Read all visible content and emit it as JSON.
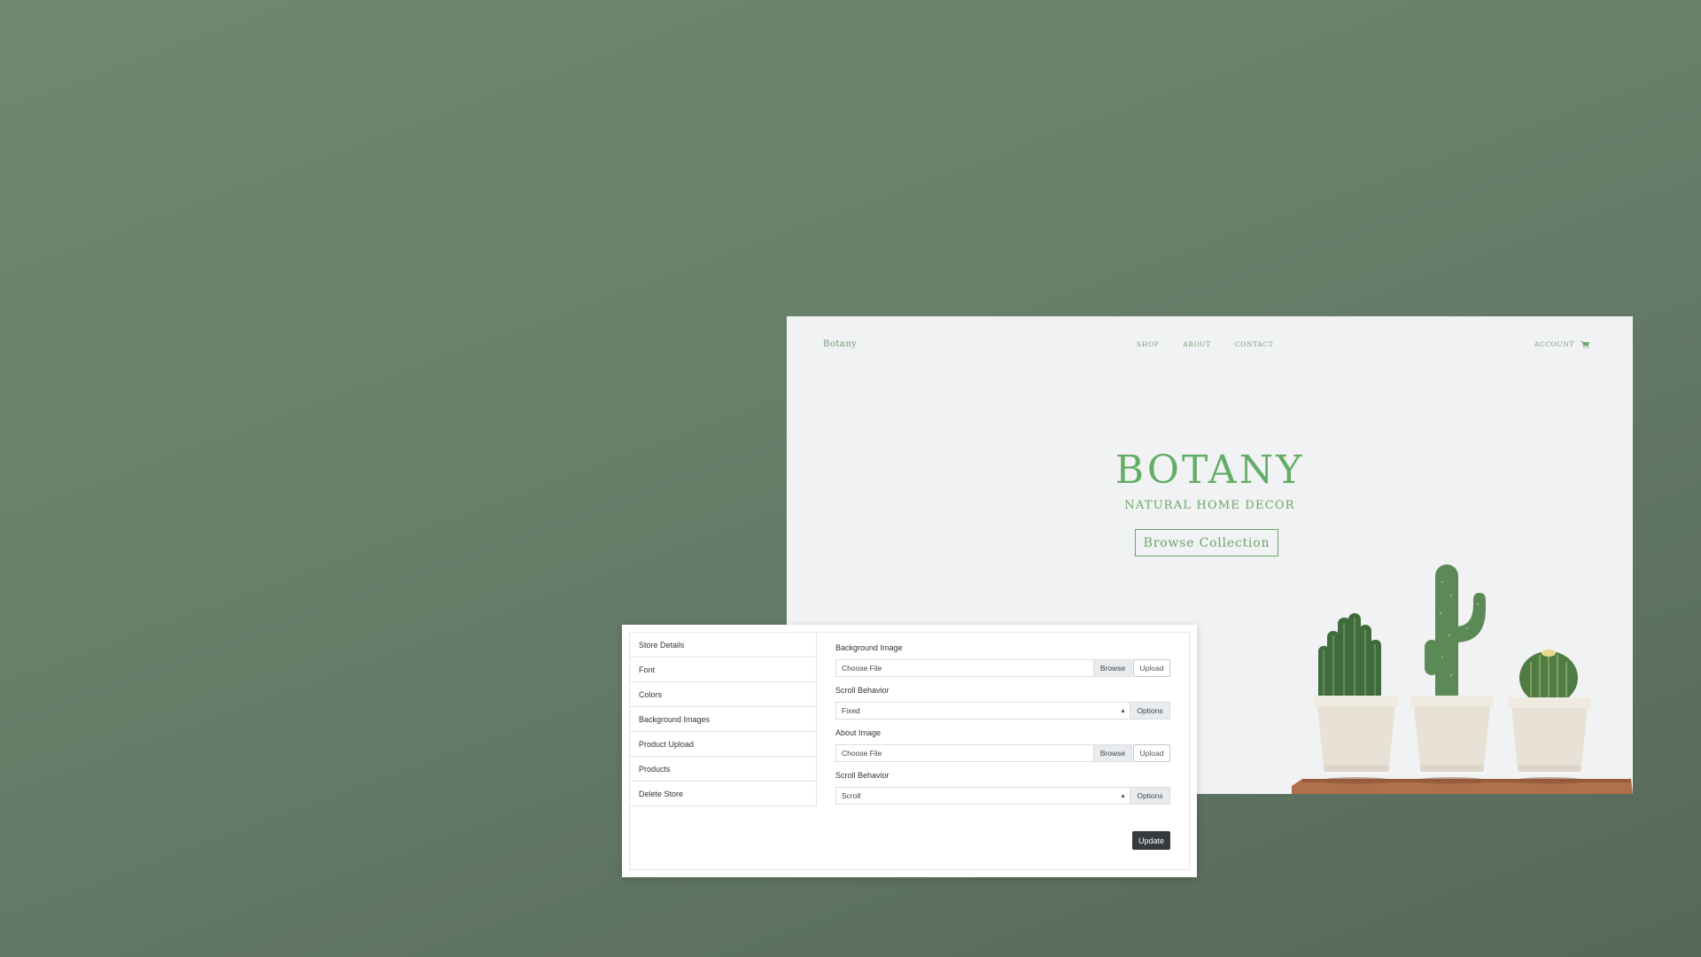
{
  "storefront": {
    "logo": "Botany",
    "nav": [
      "SHOP",
      "ABOUT",
      "CONTACT"
    ],
    "account": "ACCOUNT",
    "hero_title": "BOTANY",
    "hero_subtitle": "NATURAL HOME DECOR",
    "hero_button": "Browse Collection"
  },
  "admin": {
    "menu": [
      "Store Details",
      "Font",
      "Colors",
      "Background Images",
      "Product Upload",
      "Products",
      "Delete Store"
    ],
    "background_image": {
      "label": "Background Image",
      "file_value": "Choose File",
      "browse": "Browse",
      "upload": "Upload"
    },
    "scroll_behavior_1": {
      "label": "Scroll Behavior",
      "value": "Fixed",
      "options": "Options"
    },
    "about_image": {
      "label": "About Image",
      "file_value": "Choose File",
      "browse": "Browse",
      "upload": "Upload"
    },
    "scroll_behavior_2": {
      "label": "Scroll Behavior",
      "value": "Scroll",
      "options": "Options"
    },
    "update": "Update"
  },
  "colors": {
    "background": "#6a846e",
    "accent_green": "#64ad66",
    "dark_button": "#343a40"
  },
  "icons": {
    "cart": "cart-icon",
    "select": "select-arrows-icon"
  }
}
